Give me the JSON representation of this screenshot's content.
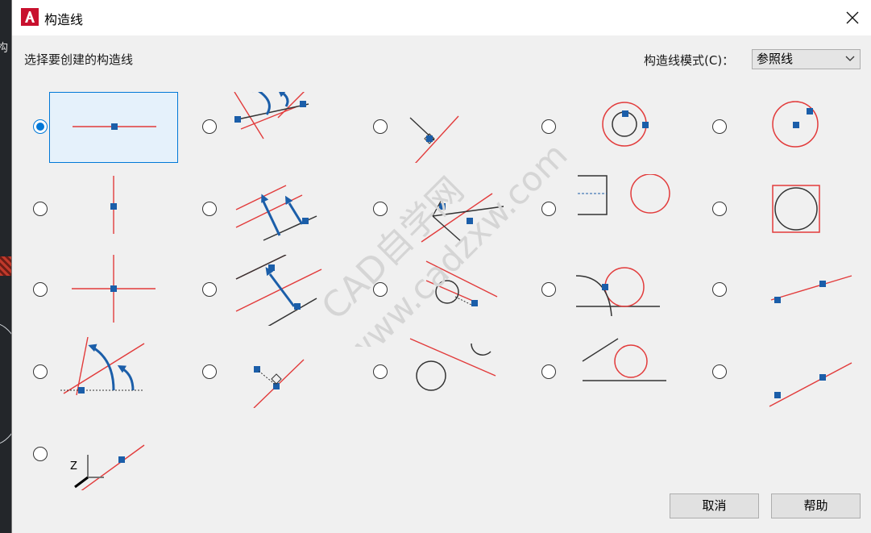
{
  "dialog": {
    "title": "构造线",
    "prompt": "选择要创建的构造线",
    "mode_label": "构造线模式(C)：",
    "mode_value": "参照线",
    "cancel_label": "取消",
    "help_label": "帮助"
  },
  "watermark": {
    "line1": "CAD自学网",
    "line2": "www.cadzxw.com"
  },
  "background": {
    "partial_text": "构"
  },
  "options": [
    {
      "icon": "horizontal-xline-icon",
      "selected": true
    },
    {
      "icon": "angle-to-line-icon",
      "selected": false
    },
    {
      "icon": "bisect-angle-icon",
      "selected": false
    },
    {
      "icon": "concentric-circles-icon",
      "selected": false
    },
    {
      "icon": "circle-through-point-icon",
      "selected": false
    },
    {
      "icon": "vertical-xline-icon",
      "selected": false
    },
    {
      "icon": "parallel-arrows-icon",
      "selected": false
    },
    {
      "icon": "angle-from-line-icon",
      "selected": false
    },
    {
      "icon": "offset-from-object-icon",
      "selected": false
    },
    {
      "icon": "circle-in-square-icon",
      "selected": false
    },
    {
      "icon": "cross-xline-icon",
      "selected": false
    },
    {
      "icon": "offset-arrow-icon",
      "selected": false
    },
    {
      "icon": "tangent-circle-offset-icon",
      "selected": false
    },
    {
      "icon": "tangent-circle-arc-icon",
      "selected": false
    },
    {
      "icon": "two-point-line-icon",
      "selected": false
    },
    {
      "icon": "angle-arcs-icon",
      "selected": false
    },
    {
      "icon": "perpendicular-point-icon",
      "selected": false
    },
    {
      "icon": "tangent-two-circles-icon",
      "selected": false
    },
    {
      "icon": "tangent-circle-line-icon",
      "selected": false
    },
    {
      "icon": "two-point-line-alt-icon",
      "selected": false
    },
    {
      "icon": "ucs-line-icon",
      "selected": false
    }
  ],
  "colors": {
    "accent": "#0078d7",
    "line_red": "#e23b3b",
    "point_blue": "#1b5ea9"
  }
}
